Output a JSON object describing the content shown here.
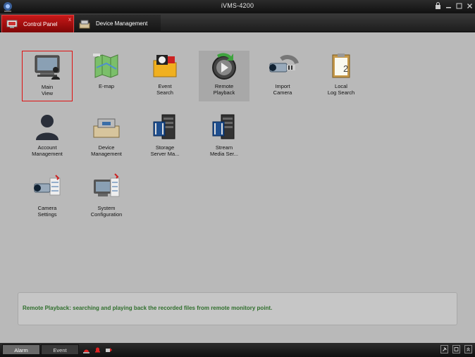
{
  "window": {
    "title": "iVMS-4200"
  },
  "tabs": [
    {
      "label": "Control Panel",
      "icon": "control-panel-icon",
      "active": true,
      "close": "x"
    },
    {
      "label": "Device Management",
      "icon": "device-management-icon",
      "active": false
    }
  ],
  "modules": [
    {
      "label": "Main\nView",
      "icon": "main-view-icon",
      "selected": true
    },
    {
      "label": "E-map",
      "icon": "e-map-icon"
    },
    {
      "label": "Event\nSearch",
      "icon": "event-search-icon"
    },
    {
      "label": "Remote\nPlayback",
      "icon": "remote-playback-icon"
    },
    {
      "label": "Import\nCamera",
      "icon": "import-camera-icon"
    },
    {
      "label": "Local\nLog Search",
      "icon": "local-log-search-icon"
    },
    {
      "label": "Account\nManagement",
      "icon": "account-management-icon"
    },
    {
      "label": "Device\nManagement",
      "icon": "device-management-module-icon"
    },
    {
      "label": "Storage\nServer Ma...",
      "icon": "storage-server-icon"
    },
    {
      "label": "Stream\nMedia Ser...",
      "icon": "stream-media-server-icon"
    },
    {
      "label": "Camera\nSettings",
      "icon": "camera-settings-icon"
    },
    {
      "label": "System\nConfiguration",
      "icon": "system-configuration-icon"
    }
  ],
  "status": {
    "text": "Remote Playback: searching and playing back the recorded files from remote monitory point."
  },
  "bottom": {
    "tabs": [
      "Alarm",
      "Event"
    ],
    "active_tab": "Alarm"
  },
  "colors": {
    "accent_red": "#c81818",
    "status_green": "#2f6f2c",
    "main_bg": "#b9b9b9"
  }
}
